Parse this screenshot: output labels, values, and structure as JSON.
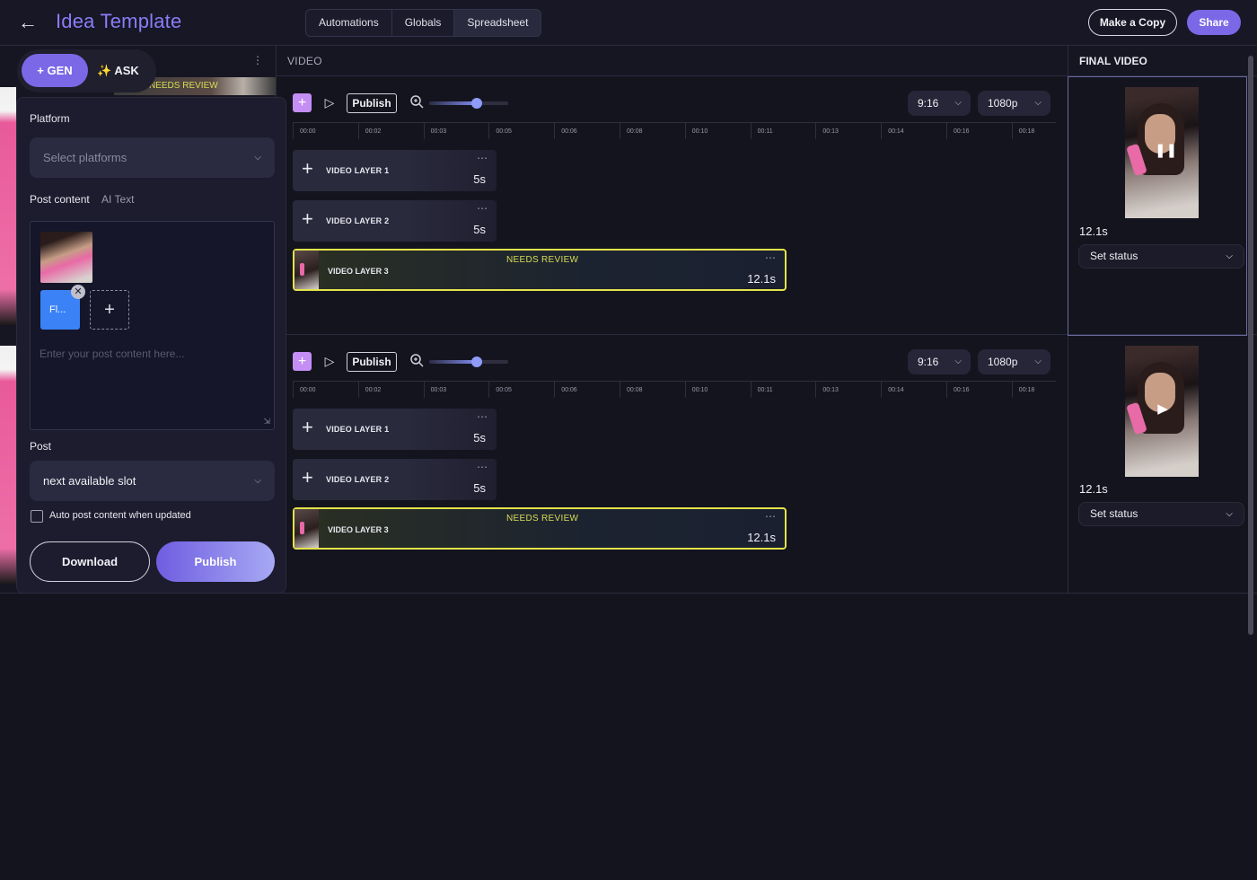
{
  "header": {
    "back_icon": "arrow-left-icon",
    "title": "Idea Template",
    "tabs": [
      "Automations",
      "Globals",
      "Spreadsheet"
    ],
    "make_copy": "Make a Copy",
    "share": "Share"
  },
  "columns": {
    "video": "VIDEO",
    "final_video": "FINAL VIDEO"
  },
  "toolbar": {
    "publish": "Publish",
    "zoom_level": 0.6,
    "aspect": "9:16",
    "resolution": "1080p"
  },
  "timeline_ticks": [
    "00:00",
    "00:02",
    "00:03",
    "00:05",
    "00:06",
    "00:08",
    "00:10",
    "00:11",
    "00:13",
    "00:14",
    "00:16",
    "00:18"
  ],
  "rows": [
    {
      "layers": [
        {
          "name": "VIDEO LAYER 1",
          "duration": "5s"
        },
        {
          "name": "VIDEO LAYER 2",
          "duration": "5s"
        },
        {
          "name": "VIDEO LAYER 3",
          "duration": "12.1s",
          "status": "NEEDS REVIEW"
        }
      ],
      "final": {
        "duration": "12.1s",
        "status": "Set status",
        "playback": "pause"
      }
    },
    {
      "layers": [
        {
          "name": "VIDEO LAYER 1",
          "duration": "5s"
        },
        {
          "name": "VIDEO LAYER 2",
          "duration": "5s"
        },
        {
          "name": "VIDEO LAYER 3",
          "duration": "12.1s",
          "status": "NEEDS REVIEW"
        }
      ],
      "final": {
        "duration": "12.1s",
        "status": "Set status",
        "playback": "play"
      }
    }
  ],
  "assistant": {
    "gen": "GEN",
    "ask": "ASK",
    "background_status": "NEEDS REVIEW"
  },
  "publish_panel": {
    "platform_label": "Platform",
    "platform_placeholder": "Select platforms",
    "post_content_label": "Post content",
    "ai_text": "AI Text",
    "file_name": "Fl...",
    "content_placeholder": "Enter your post content here...",
    "post_label": "Post",
    "slot": "next available slot",
    "auto_post_label": "Auto post content when updated",
    "auto_post_checked": false,
    "download": "Download",
    "publish": "Publish"
  },
  "colors": {
    "accent": "#7a68e6",
    "needs_review": "#e3e34a",
    "add_layer": "#c48ef5",
    "file_chip": "#3b82f6"
  }
}
